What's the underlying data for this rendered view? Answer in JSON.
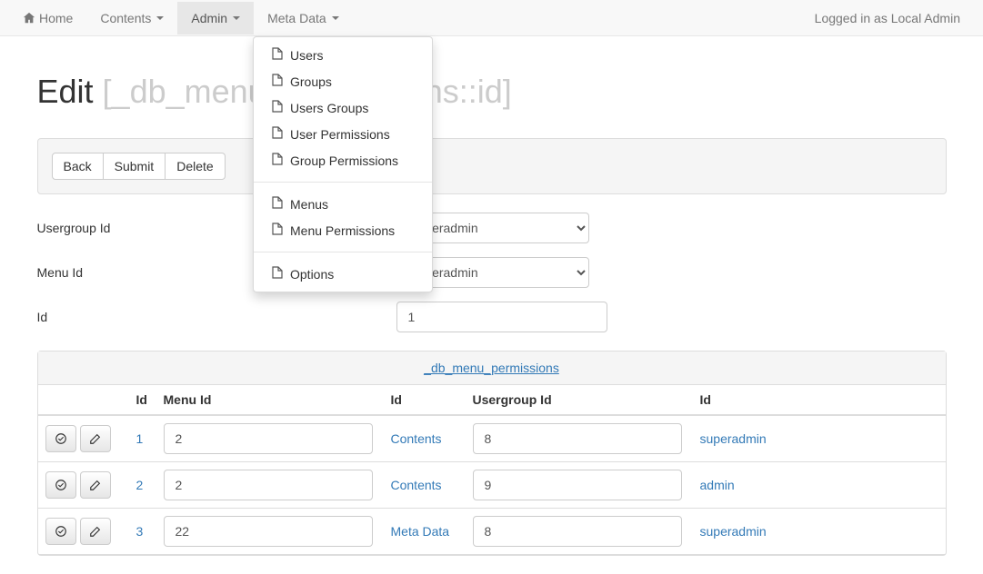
{
  "nav": {
    "home": "Home",
    "contents": "Contents",
    "admin": "Admin",
    "metadata": "Meta Data",
    "logged_in": "Logged in as Local Admin"
  },
  "dropdown": {
    "users": "Users",
    "groups": "Groups",
    "users_groups": "Users Groups",
    "user_permissions": "User Permissions",
    "group_permissions": "Group Permissions",
    "menus": "Menus",
    "menu_permissions": "Menu Permissions",
    "options": "Options"
  },
  "page": {
    "title_prefix": "Edit ",
    "title_muted": "[_db_menu_permissions::id]"
  },
  "toolbar": {
    "back": "Back",
    "submit": "Submit",
    "delete": "Delete"
  },
  "form": {
    "usergroup_label": "Usergroup Id",
    "usergroup_value": "superadmin",
    "menu_label": "Menu Id",
    "menu_value": "superadmin",
    "id_label": "Id",
    "id_value": "1"
  },
  "panel": {
    "title": "_db_menu_permissions"
  },
  "table": {
    "headers": {
      "id1": "Id",
      "menuid": "Menu Id",
      "id2": "Id",
      "ugid": "Usergroup Id",
      "id3": "Id"
    },
    "rows": [
      {
        "id1": "1",
        "menuid": "2",
        "id2": "Contents",
        "ugid": "8",
        "id3": "superadmin"
      },
      {
        "id1": "2",
        "menuid": "2",
        "id2": "Contents",
        "ugid": "9",
        "id3": "admin"
      },
      {
        "id1": "3",
        "menuid": "22",
        "id2": "Meta Data",
        "ugid": "8",
        "id3": "superadmin"
      }
    ]
  }
}
